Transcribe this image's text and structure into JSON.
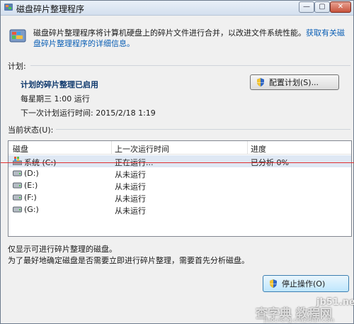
{
  "window": {
    "title": "磁盘碎片整理程序",
    "controls": {
      "minimize": "—",
      "maximize": "▢",
      "close": "✕"
    }
  },
  "header": {
    "description": "磁盘碎片整理程序将计算机硬盘上的碎片文件进行合并，以改进文件系统性能。",
    "link": "获取有关磁盘碎片整理程序的详细信息。"
  },
  "schedule": {
    "section_label": "计划:",
    "status": "计划的碎片整理已启用",
    "frequency": "每星期三 1:00 运行",
    "next_run": "下一次计划运行时间: 2015/2/18 1:19",
    "configure_button": "配置计划(S)..."
  },
  "current_status": {
    "section_label": "当前状态(U):",
    "columns": [
      "磁盘",
      "上一次运行时间",
      "进度"
    ],
    "rows": [
      {
        "disk": "系统 (C:)",
        "last_run": "正在运行...",
        "progress": "已分析 0%"
      },
      {
        "disk": "(D:)",
        "last_run": "从未运行",
        "progress": ""
      },
      {
        "disk": "(E:)",
        "last_run": "从未运行",
        "progress": ""
      },
      {
        "disk": "(F:)",
        "last_run": "从未运行",
        "progress": ""
      },
      {
        "disk": "(G:)",
        "last_run": "从未运行",
        "progress": ""
      }
    ]
  },
  "footer": {
    "note1": "仅显示可进行碎片整理的磁盘。",
    "note2": "为了最好地确定磁盘是否需要立即进行碎片整理，需要首先分析磁盘。",
    "stop_button": "停止操作(O)"
  },
  "watermark": {
    "site": "jb51.net",
    "line1": "查字典 教程网",
    "line2": "jiaocheng.chazidian.com"
  },
  "colors": {
    "accent": "#0b5fb5",
    "status_bold": "#103a6e",
    "red_line": "#e03030"
  }
}
